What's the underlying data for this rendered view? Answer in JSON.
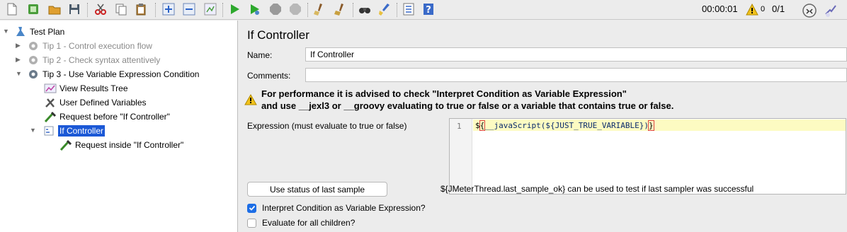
{
  "toolbar": {
    "icons": [
      "new-icon",
      "templates-icon",
      "open-icon",
      "save-icon",
      "cut-icon",
      "copy-icon",
      "paste-icon",
      "expand-icon",
      "collapse-icon",
      "toggle-icon",
      "start-icon",
      "start-no-pause-icon",
      "stop-icon",
      "shutdown-icon",
      "clear-icon",
      "clear-all-icon",
      "search-icon",
      "reset-search-icon",
      "function-helper-icon",
      "help-icon"
    ],
    "timer": "00:00:01",
    "warning_count": "0",
    "thread_count": "0/1"
  },
  "tree": {
    "nodes": [
      {
        "label": "Test Plan",
        "icon": "test-plan-icon",
        "expanded": true
      },
      {
        "label": "Tip 1 - Control execution flow",
        "icon": "gear-icon",
        "disabled": true
      },
      {
        "label": "Tip 2 - Check syntax attentively",
        "icon": "gear-icon",
        "disabled": true
      },
      {
        "label": "Tip 3 - Use Variable Expression Condition",
        "icon": "gear-icon",
        "expanded": true
      },
      {
        "label": "View Results Tree",
        "icon": "chart-icon"
      },
      {
        "label": "User Defined Variables",
        "icon": "wrench-icon"
      },
      {
        "label": "Request before \"If Controller\"",
        "icon": "pipette-icon"
      },
      {
        "label": "If Controller",
        "icon": "controller-icon",
        "selected": true,
        "expanded": true
      },
      {
        "label": "Request inside \"If Controller\"",
        "icon": "pipette-icon"
      }
    ]
  },
  "panel": {
    "title": "If Controller",
    "name_label": "Name:",
    "name_value": "If Controller",
    "comments_label": "Comments:",
    "comments_value": "",
    "warning_line1": "For performance it is advised to check \"Interpret Condition as Variable Expression\"",
    "warning_line2": "and use __jexl3 or __groovy evaluating to true or false or a variable that contains true or false.",
    "expression_label": "Expression (must evaluate to true or false)",
    "line_number": "1",
    "code_prefix": "$",
    "code_brace_open": "{",
    "code_func": "__javaScript(",
    "code_var": "${JUST_TRUE_VARIABLE}",
    "code_paren_close": ")",
    "code_brace_close": "}",
    "last_sample_button": "Use status of last sample",
    "hint": "${JMeterThread.last_sample_ok} can be used to test if last sampler was successful",
    "checkbox_interpret_label": "Interpret Condition as Variable Expression?",
    "checkbox_interpret_checked": true,
    "checkbox_all_children_label": "Evaluate for all children?",
    "checkbox_all_children_checked": false
  },
  "colors": {
    "selection": "#1b58d6",
    "checkbox_accent": "#1d6ee6",
    "line_highlight": "#fdfbc2"
  }
}
